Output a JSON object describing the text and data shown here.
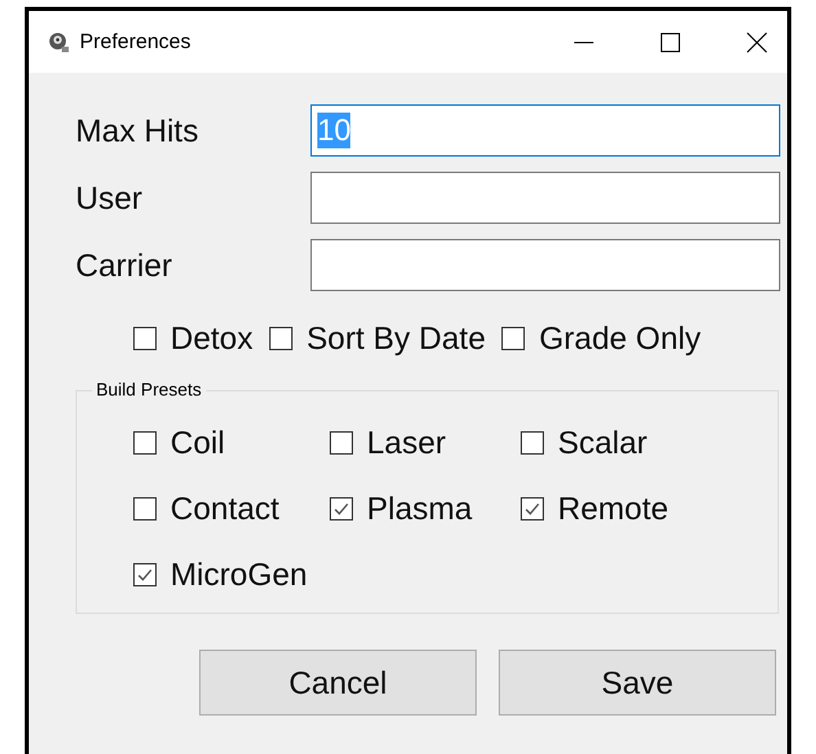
{
  "window": {
    "title": "Preferences"
  },
  "fields": [
    {
      "label": "Max Hits",
      "value": "10",
      "focused": true,
      "text_selected": true
    },
    {
      "label": "User",
      "focused": false
    },
    {
      "label": "Carrier",
      "focused": false
    }
  ],
  "options": [
    {
      "label": "Detox",
      "checked": false
    },
    {
      "label": "Sort By Date",
      "checked": false
    },
    {
      "label": "Grade Only",
      "checked": false
    }
  ],
  "build_presets": {
    "title": "Build Presets",
    "items": [
      {
        "label": "Coil",
        "checked": false
      },
      {
        "label": "Laser",
        "checked": false
      },
      {
        "label": "Scalar",
        "checked": false
      },
      {
        "label": "Contact",
        "checked": false
      },
      {
        "label": "Plasma",
        "checked": true
      },
      {
        "label": "Remote",
        "checked": true
      },
      {
        "label": "MicroGen",
        "checked": true
      }
    ]
  },
  "buttons": [
    "Cancel",
    "Save"
  ]
}
